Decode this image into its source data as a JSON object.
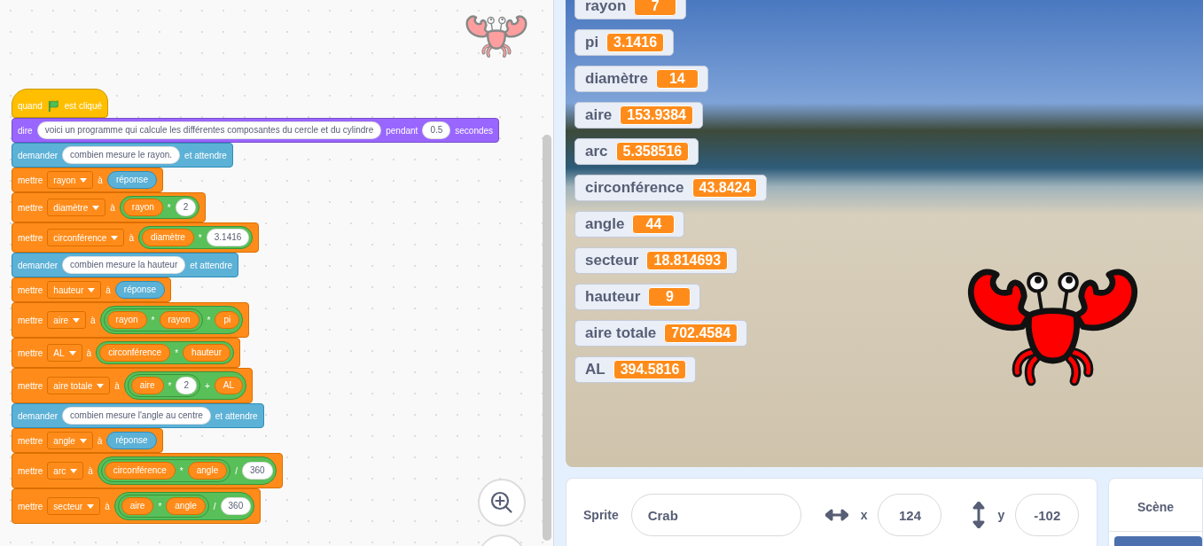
{
  "code": {
    "blocks": [
      {
        "kind": "hat",
        "parts": [
          {
            "kind": "label",
            "text": "quand"
          },
          {
            "kind": "flag"
          },
          {
            "kind": "label",
            "text": "est cliqué"
          }
        ]
      },
      {
        "kind": "looks",
        "parts": [
          {
            "kind": "label",
            "text": "dire"
          },
          {
            "kind": "text",
            "text": "voici un programme qui calcule les différentes composantes du cercle et du cylindre"
          },
          {
            "kind": "label",
            "text": "pendant"
          },
          {
            "kind": "text",
            "text": "0.5"
          },
          {
            "kind": "label",
            "text": "secondes"
          }
        ]
      },
      {
        "kind": "sensing",
        "parts": [
          {
            "kind": "label",
            "text": "demander"
          },
          {
            "kind": "text",
            "text": "combien mesure le rayon."
          },
          {
            "kind": "label",
            "text": "et attendre"
          }
        ]
      },
      {
        "kind": "variables",
        "parts": [
          {
            "kind": "label",
            "text": "mettre"
          },
          {
            "kind": "dropdown",
            "text": "rayon"
          },
          {
            "kind": "label",
            "text": "à"
          },
          {
            "kind": "answer",
            "text": "réponse"
          }
        ]
      },
      {
        "kind": "variables",
        "parts": [
          {
            "kind": "label",
            "text": "mettre"
          },
          {
            "kind": "dropdown",
            "text": "diamètre"
          },
          {
            "kind": "label",
            "text": "à"
          },
          {
            "kind": "op",
            "items": [
              {
                "kind": "var",
                "text": "rayon"
              },
              {
                "kind": "symbol",
                "text": "*"
              },
              {
                "kind": "text",
                "text": "2"
              }
            ]
          }
        ]
      },
      {
        "kind": "variables",
        "parts": [
          {
            "kind": "label",
            "text": "mettre"
          },
          {
            "kind": "dropdown",
            "text": "circonférence"
          },
          {
            "kind": "label",
            "text": "à"
          },
          {
            "kind": "op",
            "items": [
              {
                "kind": "var",
                "text": "diamètre"
              },
              {
                "kind": "symbol",
                "text": "*"
              },
              {
                "kind": "text",
                "text": "3.1416"
              }
            ]
          }
        ]
      },
      {
        "kind": "sensing",
        "parts": [
          {
            "kind": "label",
            "text": "demander"
          },
          {
            "kind": "text",
            "text": "combien mesure la hauteur"
          },
          {
            "kind": "label",
            "text": "et attendre"
          }
        ]
      },
      {
        "kind": "variables",
        "parts": [
          {
            "kind": "label",
            "text": "mettre"
          },
          {
            "kind": "dropdown",
            "text": "hauteur"
          },
          {
            "kind": "label",
            "text": "à"
          },
          {
            "kind": "answer",
            "text": "réponse"
          }
        ]
      },
      {
        "kind": "variables",
        "parts": [
          {
            "kind": "label",
            "text": "mettre"
          },
          {
            "kind": "dropdown",
            "text": "aire"
          },
          {
            "kind": "label",
            "text": "à"
          },
          {
            "kind": "op",
            "items": [
              {
                "kind": "op",
                "items": [
                  {
                    "kind": "var",
                    "text": "rayon"
                  },
                  {
                    "kind": "symbol",
                    "text": "*"
                  },
                  {
                    "kind": "var",
                    "text": "rayon"
                  }
                ]
              },
              {
                "kind": "symbol",
                "text": "*"
              },
              {
                "kind": "var",
                "text": "pi"
              }
            ]
          }
        ]
      },
      {
        "kind": "variables",
        "parts": [
          {
            "kind": "label",
            "text": "mettre"
          },
          {
            "kind": "dropdown",
            "text": "AL"
          },
          {
            "kind": "label",
            "text": "à"
          },
          {
            "kind": "op",
            "items": [
              {
                "kind": "var",
                "text": "circonférence"
              },
              {
                "kind": "symbol",
                "text": "*"
              },
              {
                "kind": "var",
                "text": "hauteur"
              }
            ]
          }
        ]
      },
      {
        "kind": "variables",
        "parts": [
          {
            "kind": "label",
            "text": "mettre"
          },
          {
            "kind": "dropdown",
            "text": "aire totale"
          },
          {
            "kind": "label",
            "text": "à"
          },
          {
            "kind": "op",
            "items": [
              {
                "kind": "op",
                "items": [
                  {
                    "kind": "var",
                    "text": "aire"
                  },
                  {
                    "kind": "symbol",
                    "text": "*"
                  },
                  {
                    "kind": "text",
                    "text": "2"
                  }
                ]
              },
              {
                "kind": "symbol",
                "text": "+"
              },
              {
                "kind": "var",
                "text": "AL"
              }
            ]
          }
        ]
      },
      {
        "kind": "sensing",
        "parts": [
          {
            "kind": "label",
            "text": "demander"
          },
          {
            "kind": "text",
            "text": "combien mesure l'angle au centre"
          },
          {
            "kind": "label",
            "text": "et attendre"
          }
        ]
      },
      {
        "kind": "variables",
        "parts": [
          {
            "kind": "label",
            "text": "mettre"
          },
          {
            "kind": "dropdown",
            "text": "angle"
          },
          {
            "kind": "label",
            "text": "à"
          },
          {
            "kind": "answer",
            "text": "réponse"
          }
        ]
      },
      {
        "kind": "variables",
        "parts": [
          {
            "kind": "label",
            "text": "mettre"
          },
          {
            "kind": "dropdown",
            "text": "arc"
          },
          {
            "kind": "label",
            "text": "à"
          },
          {
            "kind": "op",
            "items": [
              {
                "kind": "op",
                "items": [
                  {
                    "kind": "var",
                    "text": "circonférence"
                  },
                  {
                    "kind": "symbol",
                    "text": "*"
                  },
                  {
                    "kind": "var",
                    "text": "angle"
                  }
                ]
              },
              {
                "kind": "symbol",
                "text": "/"
              },
              {
                "kind": "text",
                "text": "360"
              }
            ]
          }
        ]
      },
      {
        "kind": "variables",
        "parts": [
          {
            "kind": "label",
            "text": "mettre"
          },
          {
            "kind": "dropdown",
            "text": "secteur"
          },
          {
            "kind": "label",
            "text": "à"
          },
          {
            "kind": "op",
            "items": [
              {
                "kind": "op",
                "items": [
                  {
                    "kind": "var",
                    "text": "aire"
                  },
                  {
                    "kind": "symbol",
                    "text": "*"
                  },
                  {
                    "kind": "var",
                    "text": "angle"
                  }
                ]
              },
              {
                "kind": "symbol",
                "text": "/"
              },
              {
                "kind": "text",
                "text": "360"
              }
            ]
          }
        ]
      }
    ]
  },
  "stage": {
    "monitors": [
      {
        "name": "rayon",
        "value": "7"
      },
      {
        "name": "pi",
        "value": "3.1416"
      },
      {
        "name": "diamètre",
        "value": "14"
      },
      {
        "name": "aire",
        "value": "153.9384"
      },
      {
        "name": "arc",
        "value": "5.358516"
      },
      {
        "name": "circonférence",
        "value": "43.8424"
      },
      {
        "name": "angle",
        "value": "44"
      },
      {
        "name": "secteur",
        "value": "18.814693"
      },
      {
        "name": "hauteur",
        "value": "9"
      },
      {
        "name": "aire totale",
        "value": "702.4584"
      },
      {
        "name": "AL",
        "value": "394.5816"
      }
    ]
  },
  "sprite_info": {
    "sprite_label": "Sprite",
    "sprite_name": "Crab",
    "x_label": "x",
    "x_value": "124",
    "y_label": "y",
    "y_value": "-102"
  },
  "scene_panel": {
    "title": "Scène"
  }
}
